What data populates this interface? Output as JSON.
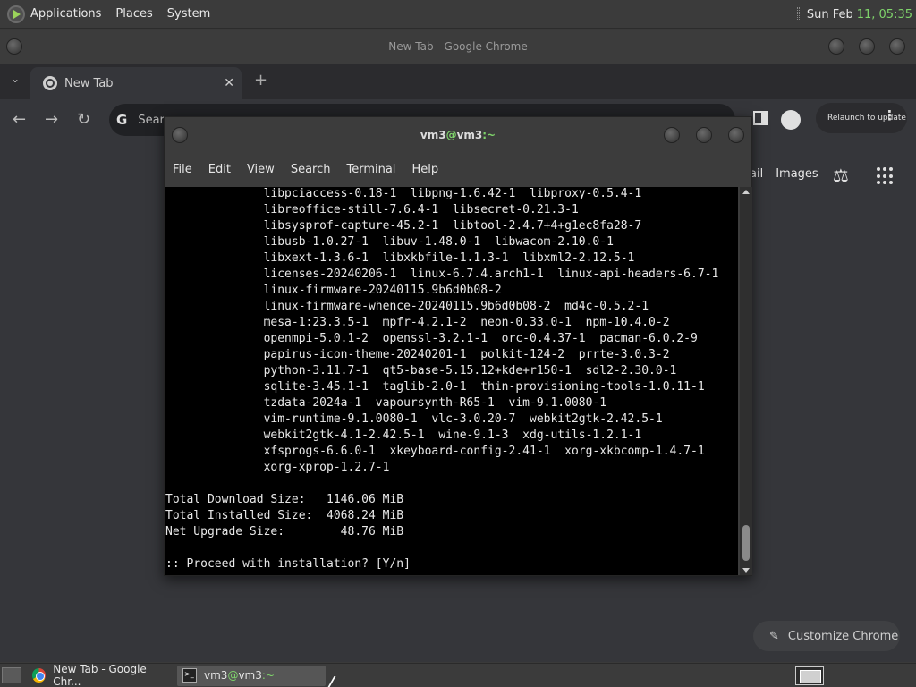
{
  "top_panel": {
    "menus": [
      "Applications",
      "Places",
      "System"
    ],
    "clock_date": "Sun Feb",
    "clock_time": "11, 05:35"
  },
  "chrome": {
    "window_title": "New Tab - Google Chrome",
    "tab_title": "New Tab",
    "tab_close": "✕",
    "new_tab": "+",
    "omnibox_text": "Sear",
    "relaunch_label": "Relaunch to update",
    "ntp_gmail": "ail",
    "ntp_images": "Images",
    "customize_label": "Customize Chrome"
  },
  "terminal": {
    "title_user": "vm3",
    "title_at": "@",
    "title_host": "vm3",
    "title_suffix": ":~",
    "menu": [
      "File",
      "Edit",
      "View",
      "Search",
      "Terminal",
      "Help"
    ],
    "lines": [
      "              libpciaccess-0.18-1  libpng-1.6.42-1  libproxy-0.5.4-1",
      "              libreoffice-still-7.6.4-1  libsecret-0.21.3-1",
      "              libsysprof-capture-45.2-1  libtool-2.4.7+4+g1ec8fa28-7",
      "              libusb-1.0.27-1  libuv-1.48.0-1  libwacom-2.10.0-1",
      "              libxext-1.3.6-1  libxkbfile-1.1.3-1  libxml2-2.12.5-1",
      "              licenses-20240206-1  linux-6.7.4.arch1-1  linux-api-headers-6.7-1",
      "              linux-firmware-20240115.9b6d0b08-2",
      "              linux-firmware-whence-20240115.9b6d0b08-2  md4c-0.5.2-1",
      "              mesa-1:23.3.5-1  mpfr-4.2.1-2  neon-0.33.0-1  npm-10.4.0-2",
      "              openmpi-5.0.1-2  openssl-3.2.1-1  orc-0.4.37-1  pacman-6.0.2-9",
      "              papirus-icon-theme-20240201-1  polkit-124-2  prrte-3.0.3-2",
      "              python-3.11.7-1  qt5-base-5.15.12+kde+r150-1  sdl2-2.30.0-1",
      "              sqlite-3.45.1-1  taglib-2.0-1  thin-provisioning-tools-1.0.11-1",
      "              tzdata-2024a-1  vapoursynth-R65-1  vim-9.1.0080-1",
      "              vim-runtime-9.1.0080-1  vlc-3.0.20-7  webkit2gtk-2.42.5-1",
      "              webkit2gtk-4.1-2.42.5-1  wine-9.1-3  xdg-utils-1.2.1-1",
      "              xfsprogs-6.6.0-1  xkeyboard-config-2.41-1  xorg-xkbcomp-1.4.7-1",
      "              xorg-xprop-1.2.7-1",
      "",
      "Total Download Size:   1146.06 MiB",
      "Total Installed Size:  4068.24 MiB",
      "Net Upgrade Size:        48.76 MiB",
      "",
      ":: Proceed with installation? [Y/n]"
    ]
  },
  "taskbar": {
    "chrome_task": "New Tab - Google Chr...",
    "term_user": "vm3",
    "term_at": "@",
    "term_host": "vm3",
    "term_suffix": ":~"
  },
  "colors": {
    "accent_green": "#7fd46b",
    "terminal_bg": "#000000",
    "panel_bg": "#3b3b3b"
  }
}
